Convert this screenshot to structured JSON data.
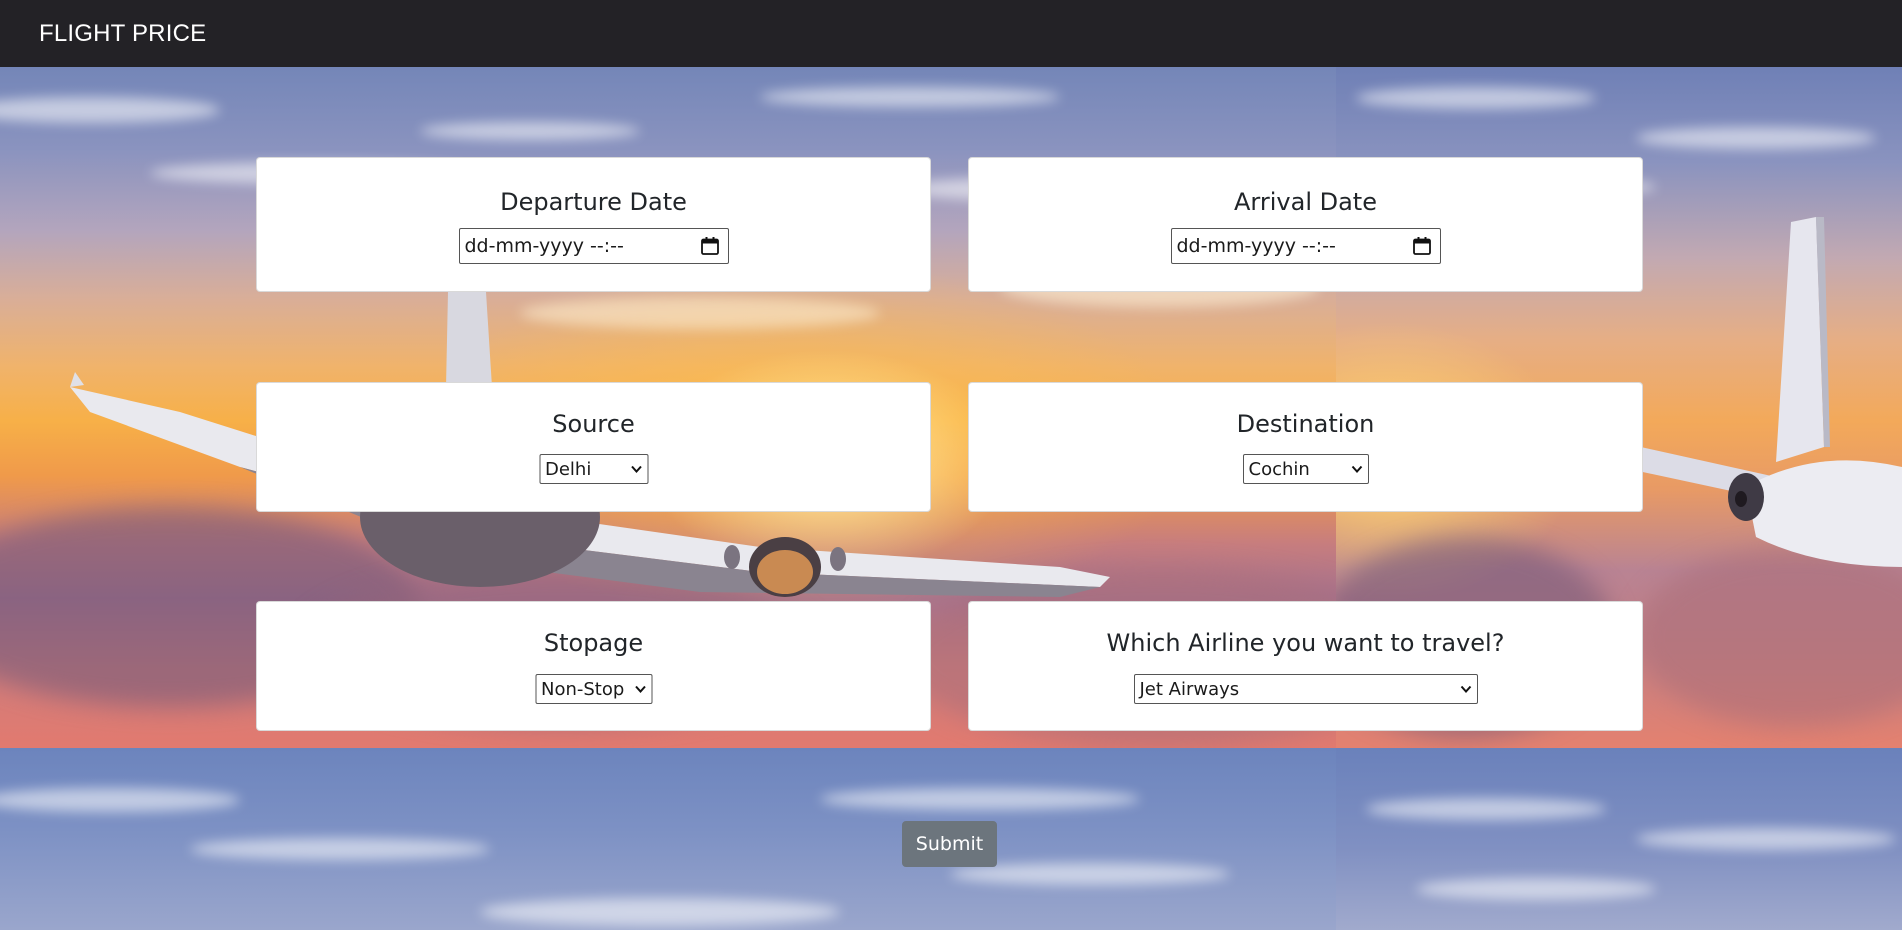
{
  "navbar": {
    "brand": "FLIGHT PRICE"
  },
  "form": {
    "departure": {
      "label": "Departure Date",
      "placeholder": "dd-mm-yyyy --:--",
      "icon": "calendar-icon"
    },
    "arrival": {
      "label": "Arrival Date",
      "placeholder": "dd-mm-yyyy --:--",
      "icon": "calendar-icon"
    },
    "source": {
      "label": "Source",
      "selected": "Delhi"
    },
    "destination": {
      "label": "Destination",
      "selected": "Cochin"
    },
    "stopage": {
      "label": "Stopage",
      "selected": "Non-Stop"
    },
    "airline": {
      "label": "Which Airline you want to travel?",
      "selected": "Jet Airways"
    },
    "submit_label": "Submit"
  },
  "colors": {
    "navbar": "#232226",
    "card": "#ffffff",
    "submit": "#6c757d"
  }
}
